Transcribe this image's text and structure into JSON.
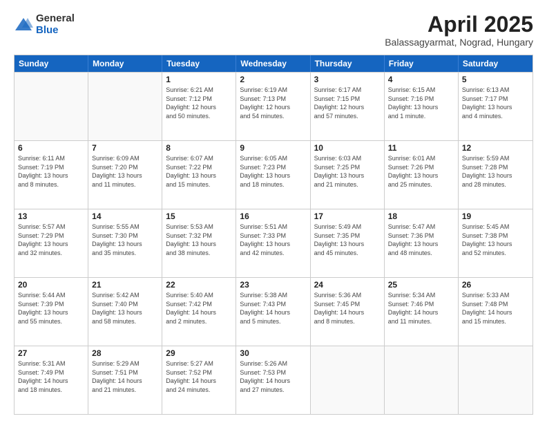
{
  "logo": {
    "general": "General",
    "blue": "Blue"
  },
  "title": "April 2025",
  "location": "Balassagyarmat, Nograd, Hungary",
  "header_days": [
    "Sunday",
    "Monday",
    "Tuesday",
    "Wednesday",
    "Thursday",
    "Friday",
    "Saturday"
  ],
  "weeks": [
    [
      {
        "day": "",
        "detail": ""
      },
      {
        "day": "",
        "detail": ""
      },
      {
        "day": "1",
        "detail": "Sunrise: 6:21 AM\nSunset: 7:12 PM\nDaylight: 12 hours\nand 50 minutes."
      },
      {
        "day": "2",
        "detail": "Sunrise: 6:19 AM\nSunset: 7:13 PM\nDaylight: 12 hours\nand 54 minutes."
      },
      {
        "day": "3",
        "detail": "Sunrise: 6:17 AM\nSunset: 7:15 PM\nDaylight: 12 hours\nand 57 minutes."
      },
      {
        "day": "4",
        "detail": "Sunrise: 6:15 AM\nSunset: 7:16 PM\nDaylight: 13 hours\nand 1 minute."
      },
      {
        "day": "5",
        "detail": "Sunrise: 6:13 AM\nSunset: 7:17 PM\nDaylight: 13 hours\nand 4 minutes."
      }
    ],
    [
      {
        "day": "6",
        "detail": "Sunrise: 6:11 AM\nSunset: 7:19 PM\nDaylight: 13 hours\nand 8 minutes."
      },
      {
        "day": "7",
        "detail": "Sunrise: 6:09 AM\nSunset: 7:20 PM\nDaylight: 13 hours\nand 11 minutes."
      },
      {
        "day": "8",
        "detail": "Sunrise: 6:07 AM\nSunset: 7:22 PM\nDaylight: 13 hours\nand 15 minutes."
      },
      {
        "day": "9",
        "detail": "Sunrise: 6:05 AM\nSunset: 7:23 PM\nDaylight: 13 hours\nand 18 minutes."
      },
      {
        "day": "10",
        "detail": "Sunrise: 6:03 AM\nSunset: 7:25 PM\nDaylight: 13 hours\nand 21 minutes."
      },
      {
        "day": "11",
        "detail": "Sunrise: 6:01 AM\nSunset: 7:26 PM\nDaylight: 13 hours\nand 25 minutes."
      },
      {
        "day": "12",
        "detail": "Sunrise: 5:59 AM\nSunset: 7:28 PM\nDaylight: 13 hours\nand 28 minutes."
      }
    ],
    [
      {
        "day": "13",
        "detail": "Sunrise: 5:57 AM\nSunset: 7:29 PM\nDaylight: 13 hours\nand 32 minutes."
      },
      {
        "day": "14",
        "detail": "Sunrise: 5:55 AM\nSunset: 7:30 PM\nDaylight: 13 hours\nand 35 minutes."
      },
      {
        "day": "15",
        "detail": "Sunrise: 5:53 AM\nSunset: 7:32 PM\nDaylight: 13 hours\nand 38 minutes."
      },
      {
        "day": "16",
        "detail": "Sunrise: 5:51 AM\nSunset: 7:33 PM\nDaylight: 13 hours\nand 42 minutes."
      },
      {
        "day": "17",
        "detail": "Sunrise: 5:49 AM\nSunset: 7:35 PM\nDaylight: 13 hours\nand 45 minutes."
      },
      {
        "day": "18",
        "detail": "Sunrise: 5:47 AM\nSunset: 7:36 PM\nDaylight: 13 hours\nand 48 minutes."
      },
      {
        "day": "19",
        "detail": "Sunrise: 5:45 AM\nSunset: 7:38 PM\nDaylight: 13 hours\nand 52 minutes."
      }
    ],
    [
      {
        "day": "20",
        "detail": "Sunrise: 5:44 AM\nSunset: 7:39 PM\nDaylight: 13 hours\nand 55 minutes."
      },
      {
        "day": "21",
        "detail": "Sunrise: 5:42 AM\nSunset: 7:40 PM\nDaylight: 13 hours\nand 58 minutes."
      },
      {
        "day": "22",
        "detail": "Sunrise: 5:40 AM\nSunset: 7:42 PM\nDaylight: 14 hours\nand 2 minutes."
      },
      {
        "day": "23",
        "detail": "Sunrise: 5:38 AM\nSunset: 7:43 PM\nDaylight: 14 hours\nand 5 minutes."
      },
      {
        "day": "24",
        "detail": "Sunrise: 5:36 AM\nSunset: 7:45 PM\nDaylight: 14 hours\nand 8 minutes."
      },
      {
        "day": "25",
        "detail": "Sunrise: 5:34 AM\nSunset: 7:46 PM\nDaylight: 14 hours\nand 11 minutes."
      },
      {
        "day": "26",
        "detail": "Sunrise: 5:33 AM\nSunset: 7:48 PM\nDaylight: 14 hours\nand 15 minutes."
      }
    ],
    [
      {
        "day": "27",
        "detail": "Sunrise: 5:31 AM\nSunset: 7:49 PM\nDaylight: 14 hours\nand 18 minutes."
      },
      {
        "day": "28",
        "detail": "Sunrise: 5:29 AM\nSunset: 7:51 PM\nDaylight: 14 hours\nand 21 minutes."
      },
      {
        "day": "29",
        "detail": "Sunrise: 5:27 AM\nSunset: 7:52 PM\nDaylight: 14 hours\nand 24 minutes."
      },
      {
        "day": "30",
        "detail": "Sunrise: 5:26 AM\nSunset: 7:53 PM\nDaylight: 14 hours\nand 27 minutes."
      },
      {
        "day": "",
        "detail": ""
      },
      {
        "day": "",
        "detail": ""
      },
      {
        "day": "",
        "detail": ""
      }
    ]
  ]
}
